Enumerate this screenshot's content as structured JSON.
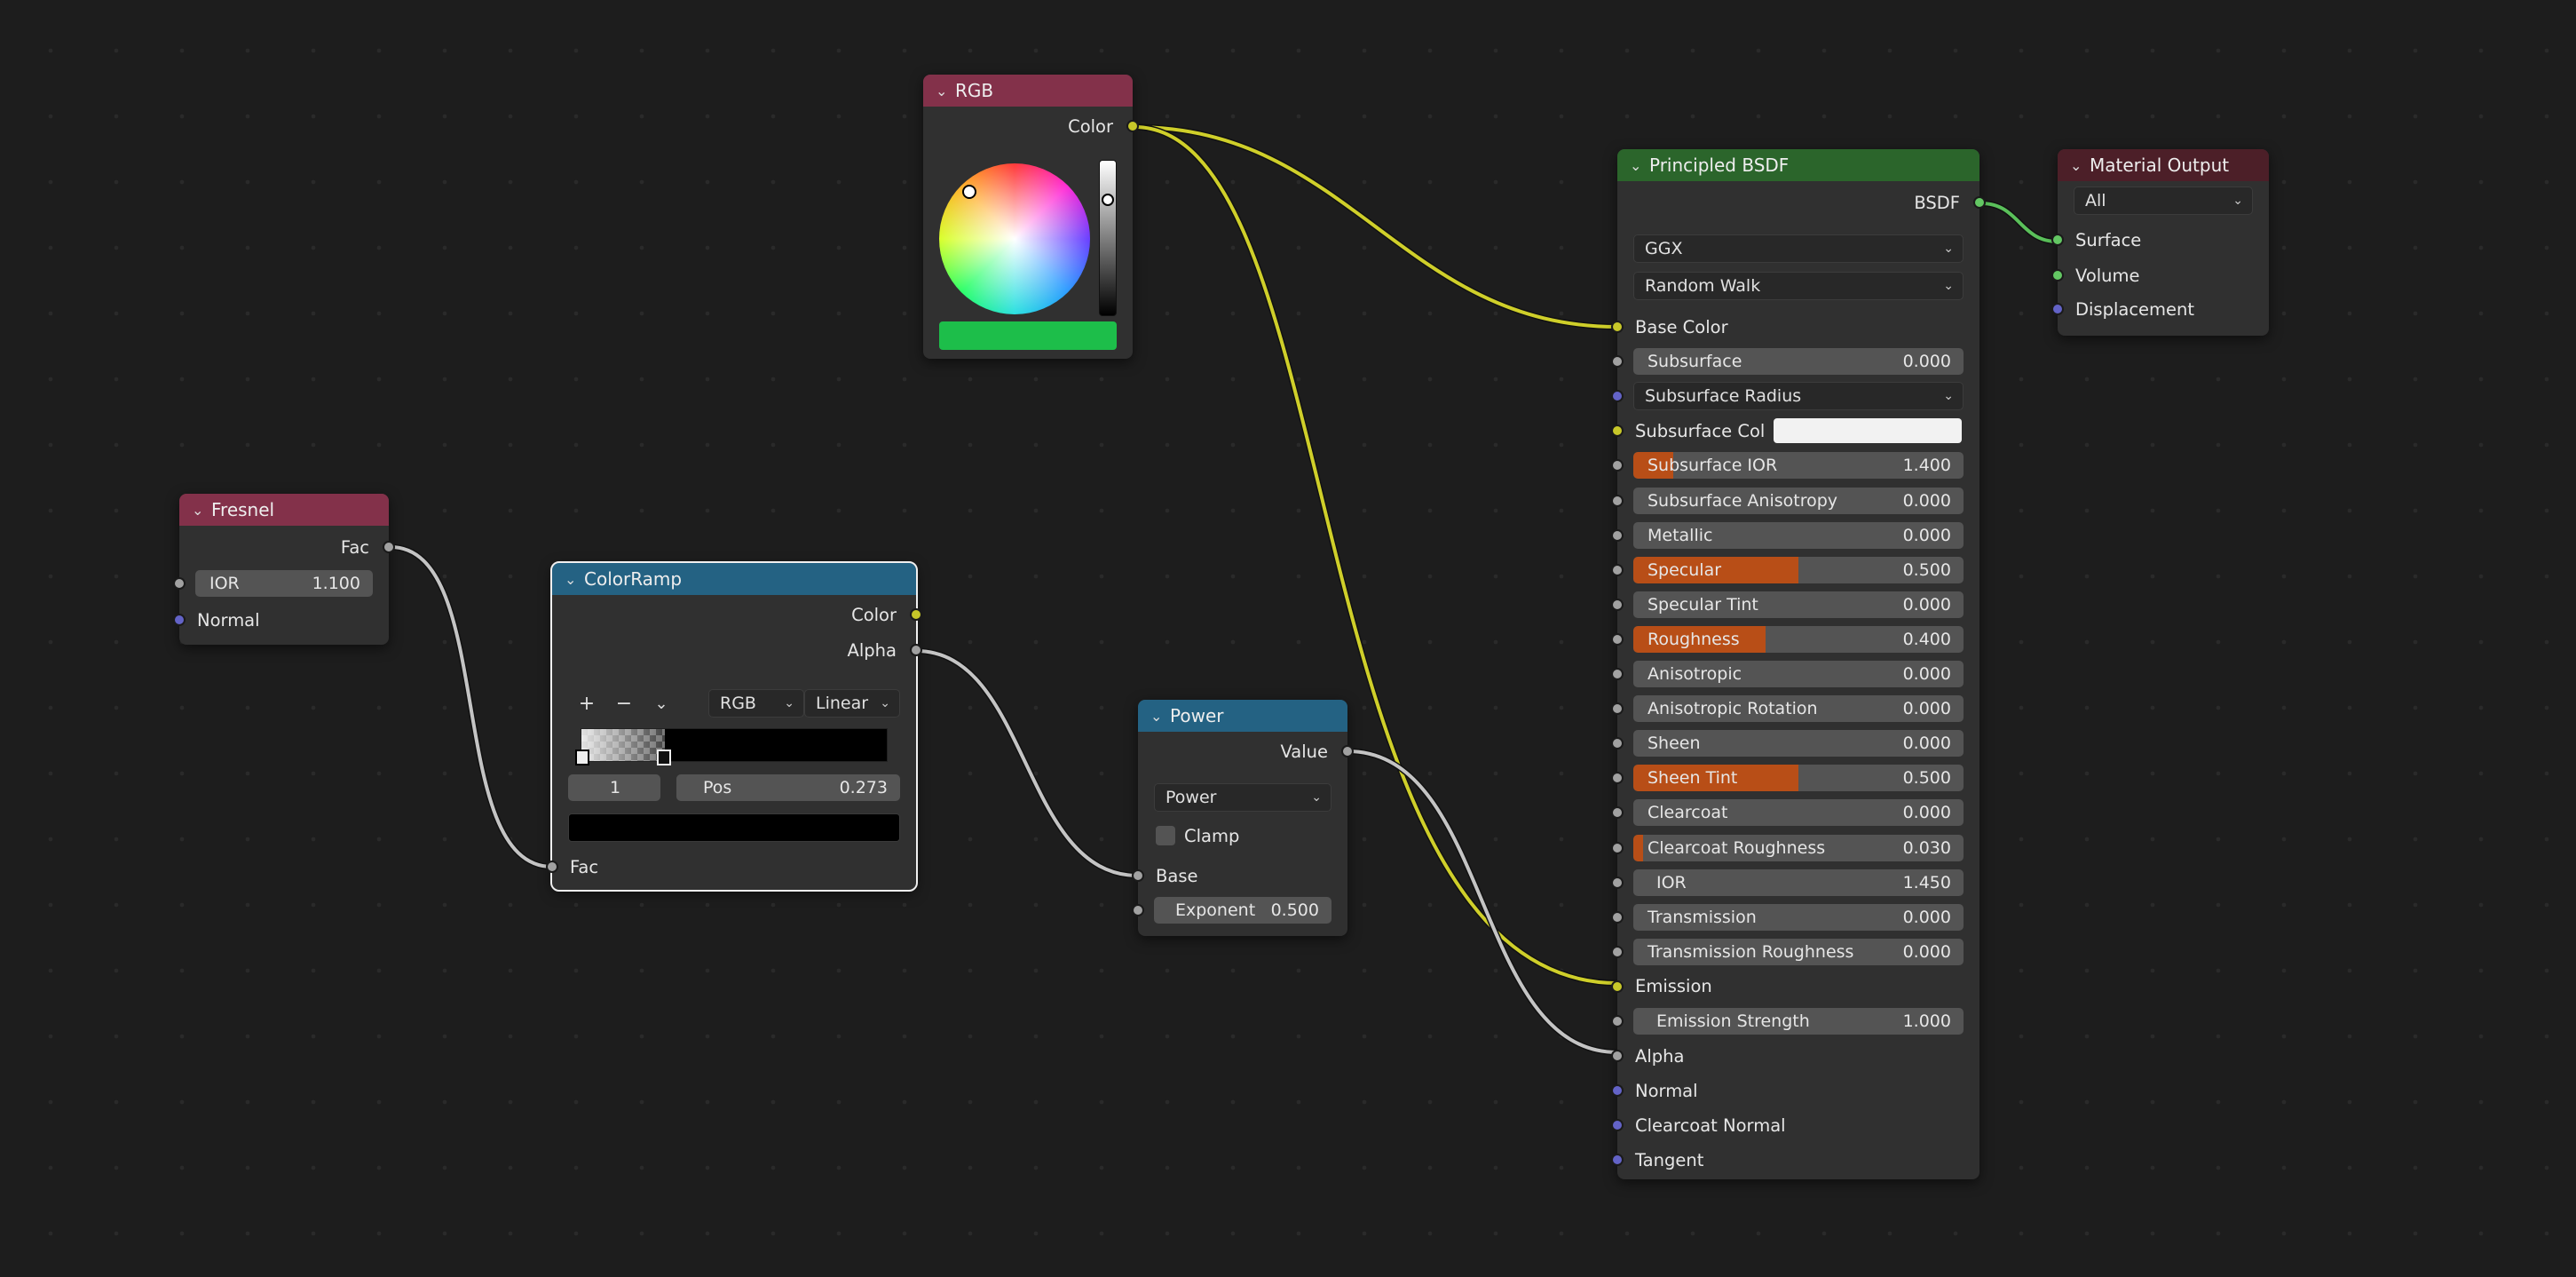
{
  "colors": {
    "socket_float": "#a1a1a1",
    "socket_color": "#c7c729",
    "socket_vector": "#6363c7",
    "socket_shader": "#63c763",
    "header_input": "#83314a",
    "header_converter": "#246283",
    "header_shader": "#2b652b",
    "header_output": "#4c1f28",
    "slider_fill": "#b84e17",
    "rgb_swatch": "#1dbe4a",
    "wire_color": "#cfcf2a",
    "wire_float": "#c4c4c4",
    "wire_shader": "#5ac05a"
  },
  "rgb_node": {
    "title": "RGB",
    "out_color": "Color"
  },
  "fresnel_node": {
    "title": "Fresnel",
    "out_fac": "Fac",
    "ior_label": "IOR",
    "ior_value": "1.100",
    "normal_label": "Normal"
  },
  "colorramp_node": {
    "title": "ColorRamp",
    "out_color": "Color",
    "out_alpha": "Alpha",
    "add_icon": "+",
    "remove_icon": "−",
    "menu_icon": "⌄",
    "color_mode": "RGB",
    "interpolation": "Linear",
    "stop_index": "1",
    "pos_label": "Pos",
    "pos_value": "0.273",
    "in_fac": "Fac"
  },
  "power_node": {
    "title": "Power",
    "out_value": "Value",
    "operation": "Power",
    "clamp_label": "Clamp",
    "clamp_checked": false,
    "in_base": "Base",
    "exponent_label": "Exponent",
    "exponent_value": "0.500"
  },
  "bsdf_node": {
    "title": "Principled BSDF",
    "out_bsdf": "BSDF",
    "distribution": "GGX",
    "subsurface_method": "Random Walk",
    "base_color": "Base Color",
    "subsurface_radius": "Subsurface Radius",
    "subsurface_col": "Subsurface Col",
    "emission": "Emission",
    "alpha": "Alpha",
    "normal": "Normal",
    "clearcoat_normal": "Clearcoat Normal",
    "tangent": "Tangent",
    "sliders": [
      {
        "label": "Subsurface",
        "value": "0.000",
        "fill": 0.0
      },
      {
        "label": "Subsurface IOR",
        "value": "1.400",
        "fill": 0.12
      },
      {
        "label": "Subsurface Anisotropy",
        "value": "0.000",
        "fill": 0.0
      },
      {
        "label": "Metallic",
        "value": "0.000",
        "fill": 0.0
      },
      {
        "label": "Specular",
        "value": "0.500",
        "fill": 0.5
      },
      {
        "label": "Specular Tint",
        "value": "0.000",
        "fill": 0.0
      },
      {
        "label": "Roughness",
        "value": "0.400",
        "fill": 0.4
      },
      {
        "label": "Anisotropic",
        "value": "0.000",
        "fill": 0.0
      },
      {
        "label": "Anisotropic Rotation",
        "value": "0.000",
        "fill": 0.0
      },
      {
        "label": "Sheen",
        "value": "0.000",
        "fill": 0.0
      },
      {
        "label": "Sheen Tint",
        "value": "0.500",
        "fill": 0.5
      },
      {
        "label": "Clearcoat",
        "value": "0.000",
        "fill": 0.0
      },
      {
        "label": "Clearcoat Roughness",
        "value": "0.030",
        "fill": 0.03
      },
      {
        "label": "IOR",
        "value": "1.450",
        "fill": 0.0
      },
      {
        "label": "Transmission",
        "value": "0.000",
        "fill": 0.0
      },
      {
        "label": "Transmission Roughness",
        "value": "0.000",
        "fill": 0.0
      }
    ],
    "emission_strength_label": "Emission Strength",
    "emission_strength_value": "1.000"
  },
  "output_node": {
    "title": "Material Output",
    "target": "All",
    "surface": "Surface",
    "volume": "Volume",
    "displacement": "Displacement"
  }
}
